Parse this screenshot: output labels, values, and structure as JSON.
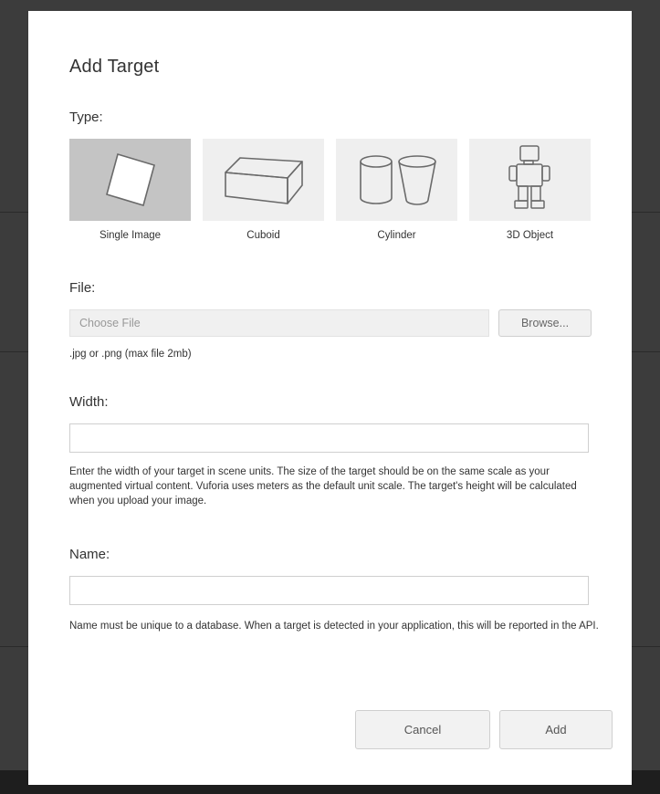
{
  "dialog": {
    "title": "Add Target",
    "type_label": "Type:",
    "types": [
      {
        "label": "Single Image",
        "icon": "single-image-icon",
        "selected": true
      },
      {
        "label": "Cuboid",
        "icon": "cuboid-icon",
        "selected": false
      },
      {
        "label": "Cylinder",
        "icon": "cylinder-icon",
        "selected": false
      },
      {
        "label": "3D Object",
        "icon": "robot-3d-object-icon",
        "selected": false
      }
    ],
    "file": {
      "label": "File:",
      "placeholder": "Choose File",
      "browse_label": "Browse...",
      "hint": ".jpg or .png (max file 2mb)"
    },
    "width": {
      "label": "Width:",
      "value": "",
      "hint": "Enter the width of your target in scene units. The size of the target should be on the same scale as your augmented virtual content. Vuforia uses meters as the default unit scale. The target's height will be calculated when you upload your image."
    },
    "name": {
      "label": "Name:",
      "value": "",
      "hint": "Name must be unique to a database. When a target is detected in your application, this will be reported in the API."
    },
    "cancel_label": "Cancel",
    "add_label": "Add"
  },
  "colors": {
    "selected_tile": "#c4c4c4",
    "tile": "#efefef",
    "backdrop": "#3c3c3c"
  }
}
